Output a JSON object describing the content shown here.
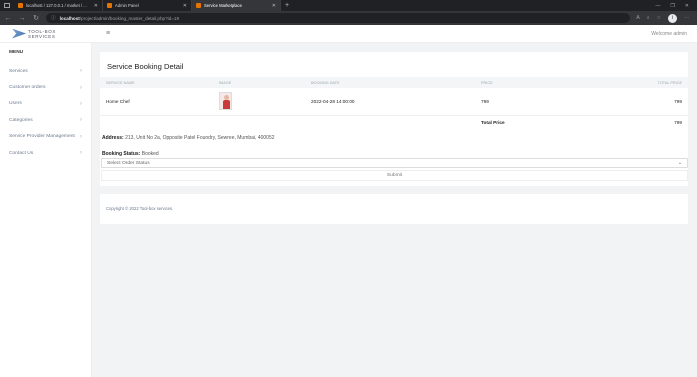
{
  "browser": {
    "tabs": [
      {
        "title": "localhost / 127.0.0.1 / market / ...",
        "color": "#e37400",
        "active": false
      },
      {
        "title": "Admin Panel",
        "color": "#e37400",
        "active": false
      },
      {
        "title": "Service Marketplace",
        "color": "#e37400",
        "active": true
      }
    ],
    "url_host": "localhost",
    "url_path": "/project/admin/booking_master_detail.php?id=19"
  },
  "header": {
    "logo_line1": "TOOL-BOX",
    "logo_line2": "SERVICES",
    "welcome": "Welcome admin"
  },
  "sidebar": {
    "title": "MENU",
    "items": [
      {
        "label": "Services"
      },
      {
        "label": "Customer orders"
      },
      {
        "label": "Users"
      },
      {
        "label": "Categories"
      },
      {
        "label": "Service Provider Management"
      },
      {
        "label": "Contact Us"
      }
    ]
  },
  "main": {
    "title": "Service Booking Detail",
    "columns": [
      "SERVICE NAME",
      "IMAGE",
      "BOOKING DATE",
      "PRICE",
      "TOTAL PRICE"
    ],
    "row": {
      "service_name": "Home Chef",
      "booking_date": "2022-04-28 14:00:00",
      "price": "799",
      "total": "799"
    },
    "total_label": "Total Price",
    "total_value": "799",
    "address_label": "Address:",
    "address_value": "213, Unit No 2a, Opposite Patel Foundry, Sewree, Mumbai, 400052",
    "status_label": "Booking Status:",
    "status_value": "Booked",
    "select_value": "Select Order Status",
    "submit_label": "Submit"
  },
  "footer": {
    "copyright": "Copyright © 2022 Tool-box services."
  }
}
